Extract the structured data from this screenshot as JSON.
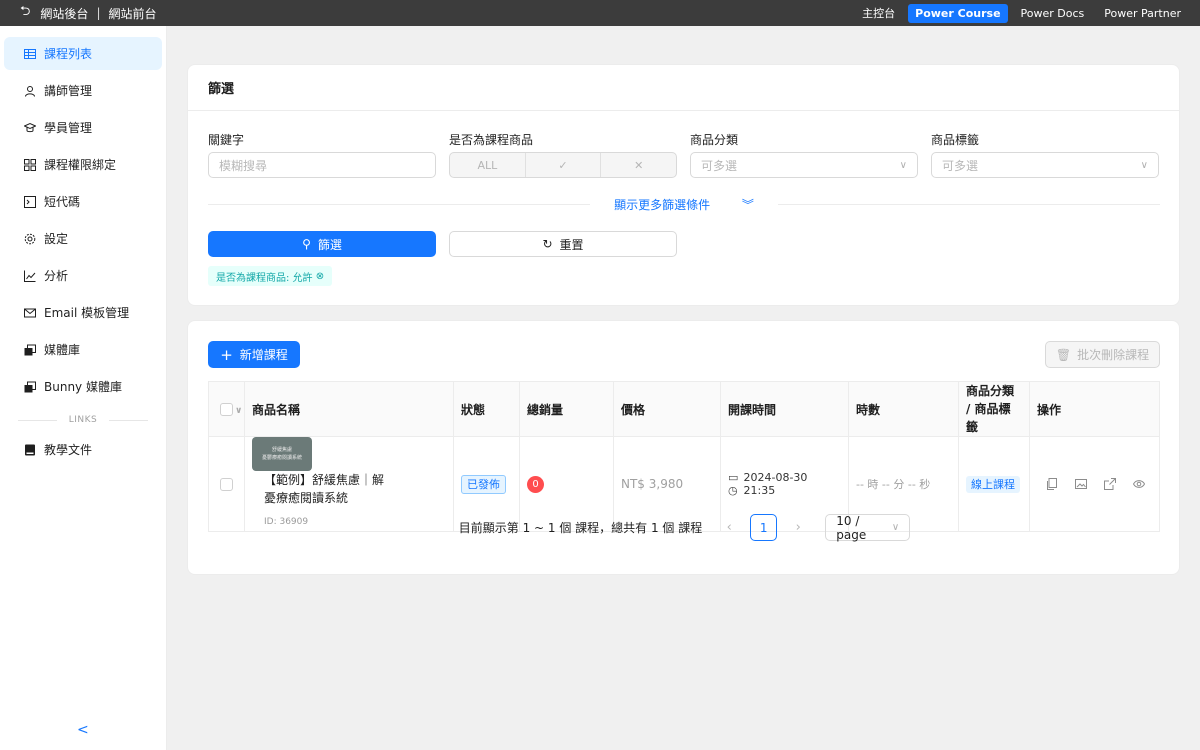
{
  "topbar": {
    "back_label": "網站後台",
    "frontend_label": "網站前台",
    "nav": [
      "主控台",
      "Power Course",
      "Power Docs",
      "Power Partner"
    ],
    "active_nav": "Power Course"
  },
  "sidebar": {
    "items": [
      {
        "label": "課程列表",
        "icon": "table-icon"
      },
      {
        "label": "講師管理",
        "icon": "user-icon"
      },
      {
        "label": "學員管理",
        "icon": "graduation-icon"
      },
      {
        "label": "課程權限綁定",
        "icon": "app-grid-icon"
      },
      {
        "label": "短代碼",
        "icon": "code-icon"
      },
      {
        "label": "設定",
        "icon": "gear-icon"
      },
      {
        "label": "分析",
        "icon": "chart-icon"
      },
      {
        "label": "Email 模板管理",
        "icon": "mail-icon"
      },
      {
        "label": "媒體庫",
        "icon": "media-icon"
      },
      {
        "label": "Bunny 媒體庫",
        "icon": "media-icon"
      }
    ],
    "links_divider": "LINKS",
    "links": [
      {
        "label": "教學文件",
        "icon": "book-icon"
      }
    ],
    "collapse_glyph": "<"
  },
  "filter": {
    "title": "篩選",
    "keyword_label": "關鍵字",
    "keyword_placeholder": "模糊搜尋",
    "is_course_label": "是否為課程商品",
    "is_course_options": [
      "ALL",
      "✓",
      "✕"
    ],
    "category_label": "商品分類",
    "category_placeholder": "可多選",
    "tag_label": "商品標籤",
    "tag_placeholder": "可多選",
    "more_label": "顯示更多篩選條件",
    "submit_label": "篩選",
    "reset_label": "重置",
    "active_tag": "是否為課程商品: 允許"
  },
  "list": {
    "add_label": "新增課程",
    "bulk_delete_label": "批次刪除課程",
    "columns": [
      "商品名稱",
      "狀態",
      "總銷量",
      "價格",
      "開課時間",
      "時數",
      "商品分類 / 商品標籤",
      "操作"
    ],
    "rows": [
      {
        "thumb_line1": "舒緩焦慮",
        "thumb_line2": "憂鬱療癒閱讀系統",
        "name": "【範例】舒緩焦慮｜解憂療癒閱讀系統",
        "id": "ID: 36909",
        "status": "已發佈",
        "sales": "0",
        "price": "NT$ 3,980",
        "date": "2024-08-30",
        "time": "21:35",
        "duration": "-- 時 -- 分 -- 秒",
        "category": "線上課程"
      }
    ]
  },
  "pagination": {
    "total_text": "目前顯示第 1 ~ 1 個 課程，總共有 1 個 課程",
    "current_page": "1",
    "page_size": "10 / page"
  }
}
